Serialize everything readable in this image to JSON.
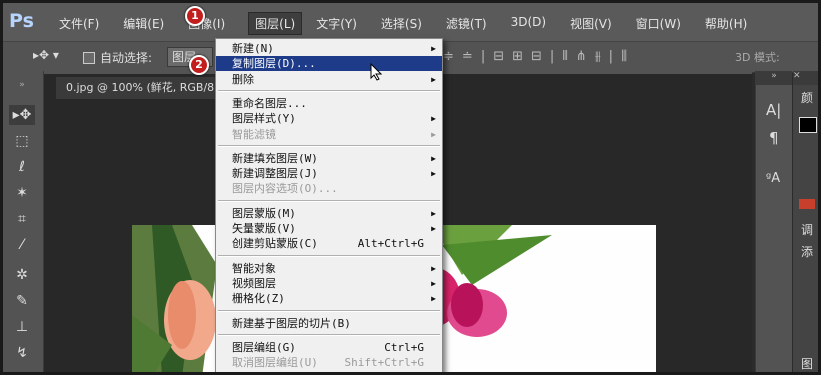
{
  "app": {
    "logo": "Ps"
  },
  "menubar": {
    "items": [
      "文件(F)",
      "编辑(E)",
      "图像(I)",
      "图层(L)",
      "文字(Y)",
      "选择(S)",
      "滤镜(T)",
      "3D(D)",
      "视图(V)",
      "窗口(W)",
      "帮助(H)"
    ],
    "active_index": 3
  },
  "badges": {
    "first": "1",
    "second": "2"
  },
  "options": {
    "auto_select_label": "自动选择:",
    "auto_select_value": "图层",
    "mode_3d": "3D 模式:"
  },
  "document": {
    "tab_title": "0.jpg @ 100% (鲜花, RGB/8"
  },
  "dropdown": {
    "items": [
      {
        "label": "新建(N)",
        "submenu": true
      },
      {
        "label": "复制图层(D)...",
        "highlight": true
      },
      {
        "label": "删除",
        "submenu": true
      },
      {
        "separator": true
      },
      {
        "label": "重命名图层..."
      },
      {
        "label": "图层样式(Y)",
        "submenu": true
      },
      {
        "label": "智能滤镜",
        "submenu": true,
        "disabled": true
      },
      {
        "separator": true
      },
      {
        "label": "新建填充图层(W)",
        "submenu": true
      },
      {
        "label": "新建调整图层(J)",
        "submenu": true
      },
      {
        "label": "图层内容选项(O)...",
        "disabled": true
      },
      {
        "separator": true
      },
      {
        "label": "图层蒙版(M)",
        "submenu": true
      },
      {
        "label": "矢量蒙版(V)",
        "submenu": true
      },
      {
        "label": "创建剪贴蒙版(C)",
        "shortcut": "Alt+Ctrl+G"
      },
      {
        "separator": true
      },
      {
        "label": "智能对象",
        "submenu": true
      },
      {
        "label": "视频图层",
        "submenu": true
      },
      {
        "label": "栅格化(Z)",
        "submenu": true
      },
      {
        "separator": true
      },
      {
        "label": "新建基于图层的切片(B)"
      },
      {
        "separator": true
      },
      {
        "label": "图层编组(G)",
        "shortcut": "Ctrl+G"
      },
      {
        "label": "取消图层编组(U)",
        "shortcut": "Shift+Ctrl+G",
        "disabled": true
      }
    ]
  },
  "right_panel": {
    "labels": [
      "颜",
      "调",
      "添",
      "图"
    ]
  }
}
